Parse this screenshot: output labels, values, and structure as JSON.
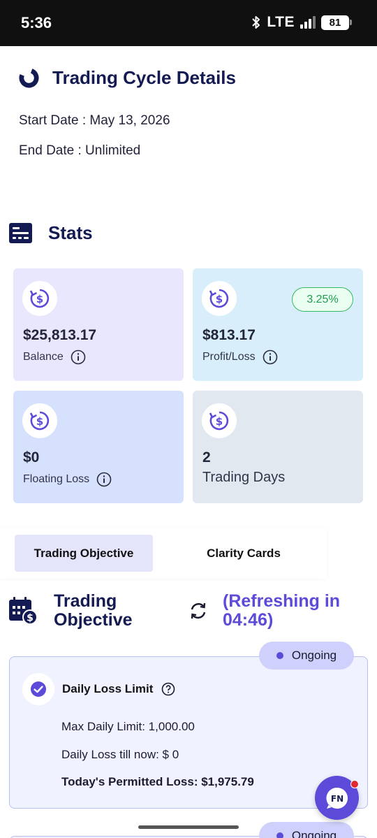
{
  "status_bar": {
    "time": "5:36",
    "bluetooth_icon": "bluetooth-icon",
    "network": "LTE",
    "battery": "81"
  },
  "cycle": {
    "title": "Trading Cycle Details",
    "start_date": "Start Date : May 13, 2026",
    "end_date": "End Date : Unlimited"
  },
  "stats": {
    "title": "Stats",
    "cards": [
      {
        "value": "$25,813.17",
        "label": "Balance",
        "bg": "#e9e7fd"
      },
      {
        "value": "$813.17",
        "label": "Profit/Loss",
        "badge": "3.25%",
        "bg": "#d8effb"
      },
      {
        "value": "$0",
        "label": "Floating Loss",
        "bg": "#d6e1fd"
      },
      {
        "value": "2",
        "label": "Trading Days",
        "bg": "#e2e8ef"
      }
    ]
  },
  "tabs": [
    {
      "label": "Trading Objective",
      "active": true
    },
    {
      "label": "Clarity Cards",
      "active": false
    }
  ],
  "objective": {
    "title": "Trading Objective",
    "refresh_text": "(Refreshing in 04:46)",
    "status_label": "Ongoing",
    "daily_loss": {
      "title": "Daily Loss Limit",
      "max_daily_limit": "Max Daily Limit: 1,000.00",
      "loss_till_now": "Daily Loss till now: $ 0",
      "permitted_loss": "Today's Permitted Loss: $1,975.79"
    },
    "next_status_label": "Ongoing"
  },
  "chat_button": {
    "label": "FN"
  },
  "colors": {
    "accent": "#5b4bd8",
    "heading": "#141a52",
    "success": "#1f9d4e"
  }
}
